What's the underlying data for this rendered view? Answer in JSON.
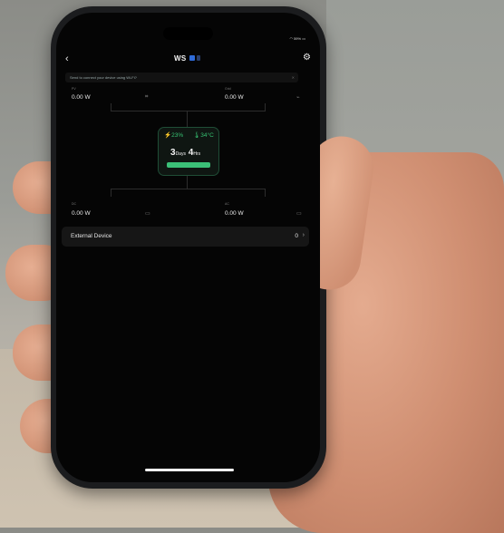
{
  "header": {
    "title": "WS"
  },
  "banner": {
    "text": "Send to connect your device using Wi-Fi?"
  },
  "ports": {
    "top_left": {
      "label": "PV",
      "value": "0.00 W"
    },
    "top_right": {
      "label": "Grid",
      "value": "0.00 W"
    },
    "bottom_left": {
      "label": "DC",
      "value": "0.00 W"
    },
    "bottom_right": {
      "label": "AC",
      "value": "0.00 W"
    }
  },
  "battery": {
    "percent": "23%",
    "temperature": "34°C",
    "runtime_days": "3",
    "runtime_days_unit": "Days",
    "runtime_hours": "4",
    "runtime_hours_unit": "Hrs",
    "level_fraction": 1.0
  },
  "external_device": {
    "label": "External Device",
    "count": "0"
  },
  "status": {
    "battery": "59%"
  },
  "colors": {
    "accent": "#37c272",
    "background": "#050505"
  }
}
